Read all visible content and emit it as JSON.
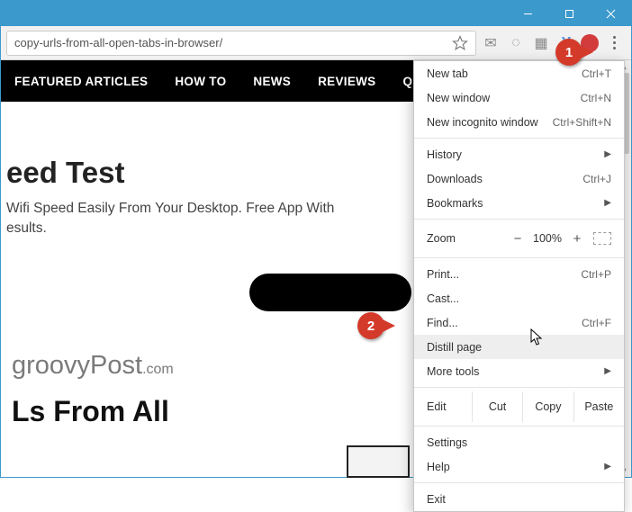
{
  "window": {
    "url": "copy-urls-from-all-open-tabs-in-browser/"
  },
  "nav": {
    "items": [
      "FEATURED ARTICLES",
      "HOW TO",
      "NEWS",
      "REVIEWS",
      "QUIC"
    ]
  },
  "page": {
    "headline": "eed Test",
    "subline1": "Wifi Speed Easily From Your Desktop. Free App With",
    "subline2": "esults.",
    "logo": "groovyPost",
    "logo_suffix": ".com",
    "sub_headline": "Ls From All"
  },
  "menu": {
    "new_tab": "New tab",
    "new_tab_k": "Ctrl+T",
    "new_window": "New window",
    "new_window_k": "Ctrl+N",
    "new_incog": "New incognito window",
    "new_incog_k": "Ctrl+Shift+N",
    "history": "History",
    "downloads": "Downloads",
    "downloads_k": "Ctrl+J",
    "bookmarks": "Bookmarks",
    "zoom": "Zoom",
    "zoom_val": "100%",
    "print": "Print...",
    "print_k": "Ctrl+P",
    "cast": "Cast...",
    "find": "Find...",
    "find_k": "Ctrl+F",
    "distill": "Distill page",
    "more_tools": "More tools",
    "edit": "Edit",
    "cut": "Cut",
    "copy": "Copy",
    "paste": "Paste",
    "settings": "Settings",
    "help": "Help",
    "exit": "Exit"
  },
  "callouts": {
    "one": "1",
    "two": "2"
  }
}
